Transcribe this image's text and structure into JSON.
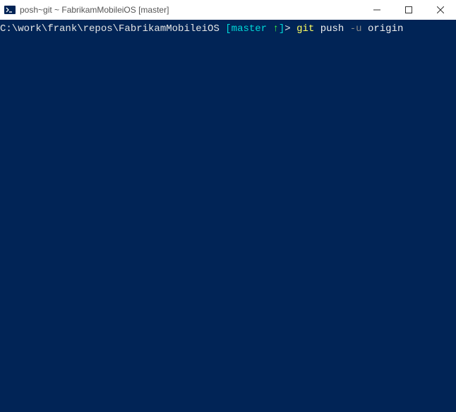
{
  "window": {
    "title": "posh~git ~ FabrikamMobileiOS [master]"
  },
  "prompt": {
    "path": "C:\\work\\frank\\repos\\FabrikamMobileiOS ",
    "branch_open": "[",
    "branch_name": "master ",
    "branch_arrow": "↑",
    "branch_close": "]",
    "prompt_char": "> ",
    "git_keyword": "git",
    "cmd_part1": " push ",
    "flag": "-u",
    "cmd_part2": " origin"
  }
}
